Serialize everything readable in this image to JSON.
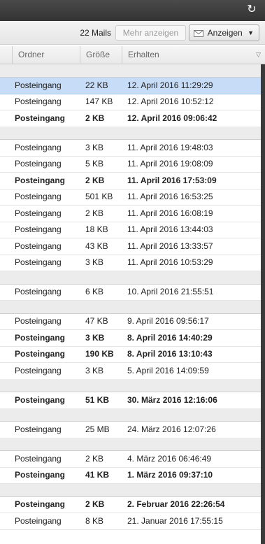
{
  "toolbar": {
    "mail_count": "22 Mails",
    "more_label": "Mehr anzeigen",
    "show_label": "Anzeigen",
    "refresh_icon": "refresh-icon",
    "envelope_icon": "envelope-icon"
  },
  "columns": {
    "folder": "Ordner",
    "size": "Größe",
    "received": "Erhalten"
  },
  "rows": [
    {
      "type": "sep"
    },
    {
      "type": "mail",
      "folder": "Posteingang",
      "size": "22 KB",
      "received": "12. April 2016 11:29:29",
      "unread": false,
      "selected": true
    },
    {
      "type": "mail",
      "folder": "Posteingang",
      "size": "147 KB",
      "received": "12. April 2016 10:52:12",
      "unread": false
    },
    {
      "type": "mail",
      "folder": "Posteingang",
      "size": "2 KB",
      "received": "12. April 2016 09:06:42",
      "unread": true
    },
    {
      "type": "sep"
    },
    {
      "type": "mail",
      "folder": "Posteingang",
      "size": "3 KB",
      "received": "11. April 2016 19:48:03",
      "unread": false
    },
    {
      "type": "mail",
      "folder": "Posteingang",
      "size": "5 KB",
      "received": "11. April 2016 19:08:09",
      "unread": false
    },
    {
      "type": "mail",
      "folder": "Posteingang",
      "size": "2 KB",
      "received": "11. April 2016 17:53:09",
      "unread": true
    },
    {
      "type": "mail",
      "folder": "Posteingang",
      "size": "501 KB",
      "received": "11. April 2016 16:53:25",
      "unread": false
    },
    {
      "type": "mail",
      "folder": "Posteingang",
      "size": "2 KB",
      "received": "11. April 2016 16:08:19",
      "unread": false
    },
    {
      "type": "mail",
      "folder": "Posteingang",
      "size": "18 KB",
      "received": "11. April 2016 13:44:03",
      "unread": false
    },
    {
      "type": "mail",
      "folder": "Posteingang",
      "size": "43 KB",
      "received": "11. April 2016 13:33:57",
      "unread": false
    },
    {
      "type": "mail",
      "folder": "Posteingang",
      "size": "3 KB",
      "received": "11. April 2016 10:53:29",
      "unread": false
    },
    {
      "type": "sep"
    },
    {
      "type": "mail",
      "folder": "Posteingang",
      "size": "6 KB",
      "received": "10. April 2016 21:55:51",
      "unread": false
    },
    {
      "type": "sep"
    },
    {
      "type": "mail",
      "folder": "Posteingang",
      "size": "47 KB",
      "received": "9. April 2016 09:56:17",
      "unread": false
    },
    {
      "type": "mail",
      "folder": "Posteingang",
      "size": "3 KB",
      "received": "8. April 2016 14:40:29",
      "unread": true
    },
    {
      "type": "mail",
      "folder": "Posteingang",
      "size": "190 KB",
      "received": "8. April 2016 13:10:43",
      "unread": true
    },
    {
      "type": "mail",
      "folder": "Posteingang",
      "size": "3 KB",
      "received": "5. April 2016 14:09:59",
      "unread": false
    },
    {
      "type": "sep"
    },
    {
      "type": "mail",
      "folder": "Posteingang",
      "size": "51 KB",
      "received": "30. März 2016 12:16:06",
      "unread": true
    },
    {
      "type": "sep"
    },
    {
      "type": "mail",
      "folder": "Posteingang",
      "size": "25 MB",
      "received": "24. März 2016 12:07:26",
      "unread": false
    },
    {
      "type": "sep"
    },
    {
      "type": "mail",
      "folder": "Posteingang",
      "size": "2 KB",
      "received": "4. März 2016 06:46:49",
      "unread": false
    },
    {
      "type": "mail",
      "folder": "Posteingang",
      "size": "41 KB",
      "received": "1. März 2016 09:37:10",
      "unread": true
    },
    {
      "type": "sep"
    },
    {
      "type": "mail",
      "folder": "Posteingang",
      "size": "2 KB",
      "received": "2. Februar 2016 22:26:54",
      "unread": true
    },
    {
      "type": "mail",
      "folder": "Posteingang",
      "size": "8 KB",
      "received": "21. Januar 2016 17:55:15",
      "unread": false
    }
  ]
}
